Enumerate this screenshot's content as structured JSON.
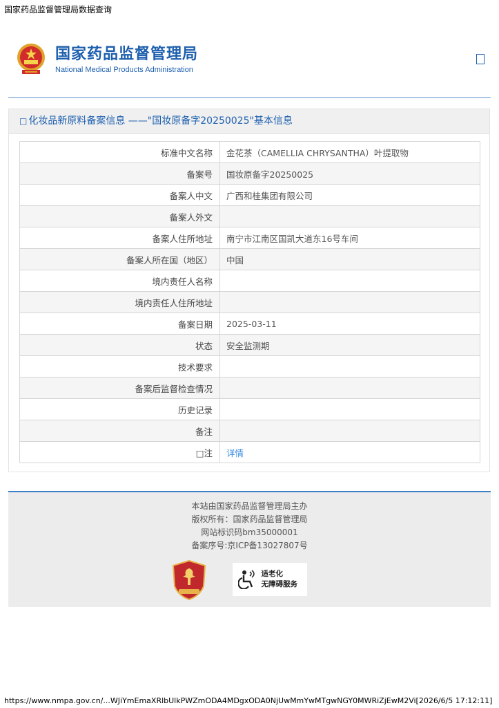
{
  "print_header": "国家药品监督管理局数据查询",
  "print_footer": "https://www.nmpa.gov.cn/...WJiYmEmaXRlbUlkPWZmODA4MDgxODA0NjUwMmYwMTgwNGY0MWRiZjEwM2Vi[2026/6/5 17:12:11]",
  "header": {
    "org_name_cn": "国家药品监督管理局",
    "org_name_en": "National Medical Products Administration",
    "emblem_icon": "national-emblem-icon",
    "menu_icon": "menu-placeholder-icon"
  },
  "panel": {
    "title_marker": "□",
    "title": "化妆品新原料备案信息 ——\"国妆原备字20250025\"基本信息"
  },
  "rows": [
    {
      "label": "标准中文名称",
      "value": "金花茶（CAMELLIA CHRYSANTHA）叶提取物"
    },
    {
      "label": "备案号",
      "value": "国妆原备字20250025"
    },
    {
      "label": "备案人中文",
      "value": "广西和桂集团有限公司"
    },
    {
      "label": "备案人外文",
      "value": ""
    },
    {
      "label": "备案人住所地址",
      "value": "南宁市江南区国凯大道东16号车间"
    },
    {
      "label": "备案人所在国（地区）",
      "value": "中国"
    },
    {
      "label": "境内责任人名称",
      "value": ""
    },
    {
      "label": "境内责任人住所地址",
      "value": ""
    },
    {
      "label": "备案日期",
      "value": "2025-03-11"
    },
    {
      "label": "状态",
      "value": "安全监测期"
    },
    {
      "label": "技术要求",
      "value": ""
    },
    {
      "label": "备案后监督检查情况",
      "value": ""
    },
    {
      "label": "历史记录",
      "value": ""
    },
    {
      "label": "备注",
      "value": ""
    }
  ],
  "note_row": {
    "label": "□注",
    "link": "详情"
  },
  "footer": {
    "lines": [
      "本站由国家药品监督管理局主办",
      "版权所有：国家药品监督管理局",
      "网站标识码bm35000001",
      "备案序号:京ICP备13027807号"
    ],
    "gov_badge_icon": "party-government-badge-icon",
    "accessibility": {
      "icon": "wheelchair-icon",
      "line1": "适老化",
      "line2": "无障碍服务"
    }
  },
  "colors": {
    "brand_blue": "#1d5fae",
    "link_blue": "#3b8be0",
    "badge_red": "#c0282c"
  }
}
